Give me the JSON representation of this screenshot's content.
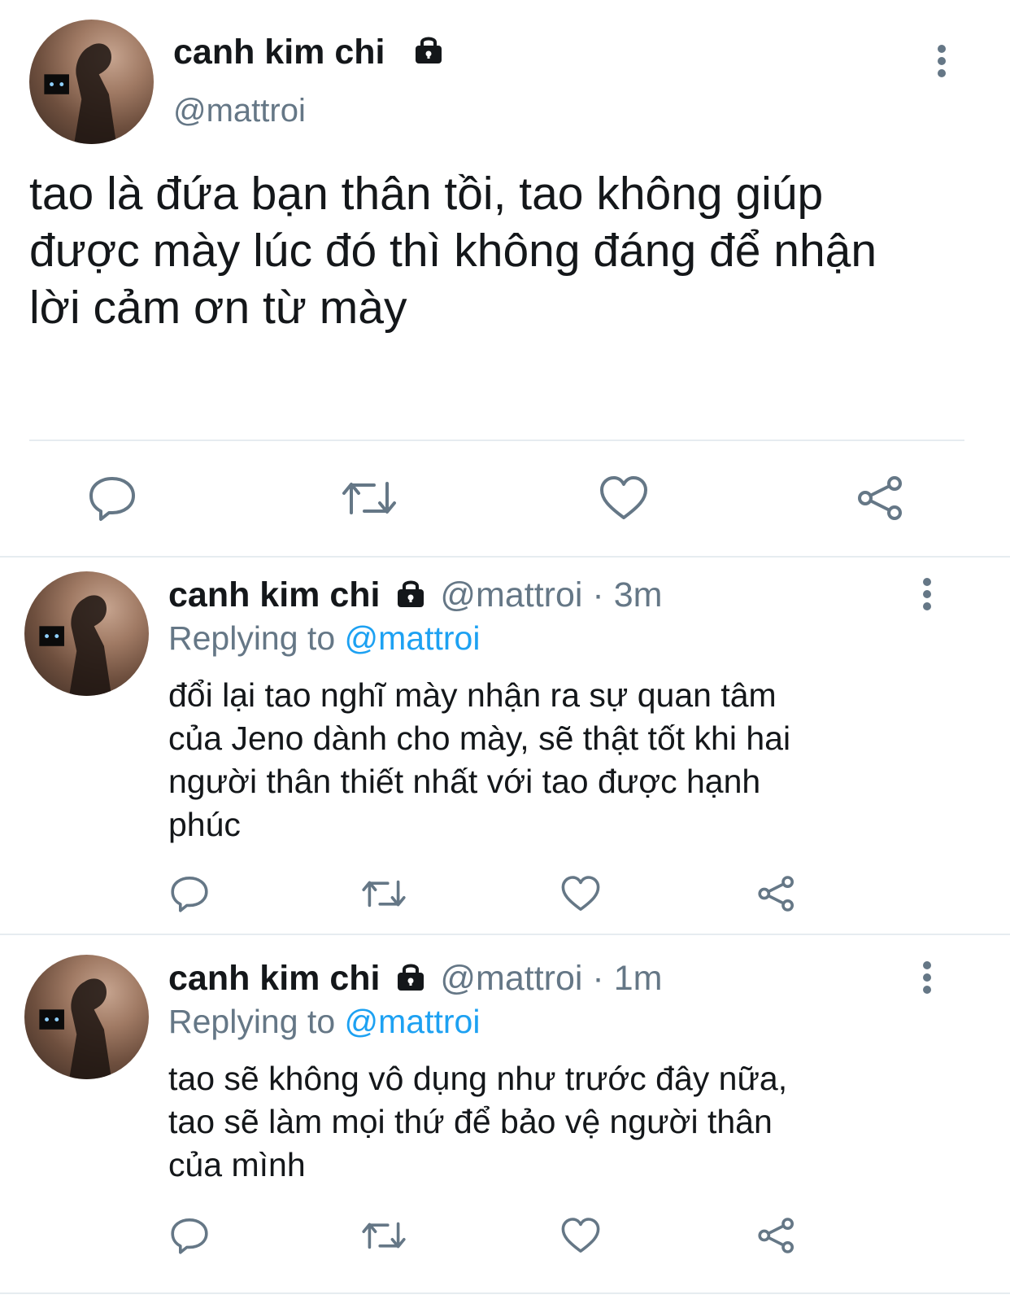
{
  "main_tweet": {
    "display_name": "canh kim chi",
    "handle": "@mattroi",
    "text": "tao là đứa bạn thân tồi, tao không giúp\nđược mày lúc đó thì không đáng để nhận\nlời cảm ơn từ mày",
    "actions": [
      "reply-icon",
      "retweet-icon",
      "like-icon",
      "share-icon"
    ]
  },
  "replies": [
    {
      "display_name": "canh kim chi",
      "handle": "@mattroi",
      "separator": "·",
      "time": "3m",
      "replying_prefix": "Replying to",
      "replying_handle": "@mattroi",
      "text": "đổi lại tao nghĩ mày nhận ra sự quan tâm\ncủa Jeno dành cho mày, sẽ thật tốt khi hai\nngười thân thiết nhất với tao được hạnh\nphúc"
    },
    {
      "display_name": "canh kim chi",
      "handle": "@mattroi",
      "separator": "·",
      "time": "1m",
      "replying_prefix": "Replying to",
      "replying_handle": "@mattroi",
      "text": "tao sẽ không vô dụng như trước đây nữa,\ntao sẽ làm mọi thứ để bảo vệ người thân\ncủa mình"
    }
  ],
  "colors": {
    "text": "#14171a",
    "secondary": "#657786",
    "link": "#1da1f2",
    "divider": "#e6ecf0"
  }
}
